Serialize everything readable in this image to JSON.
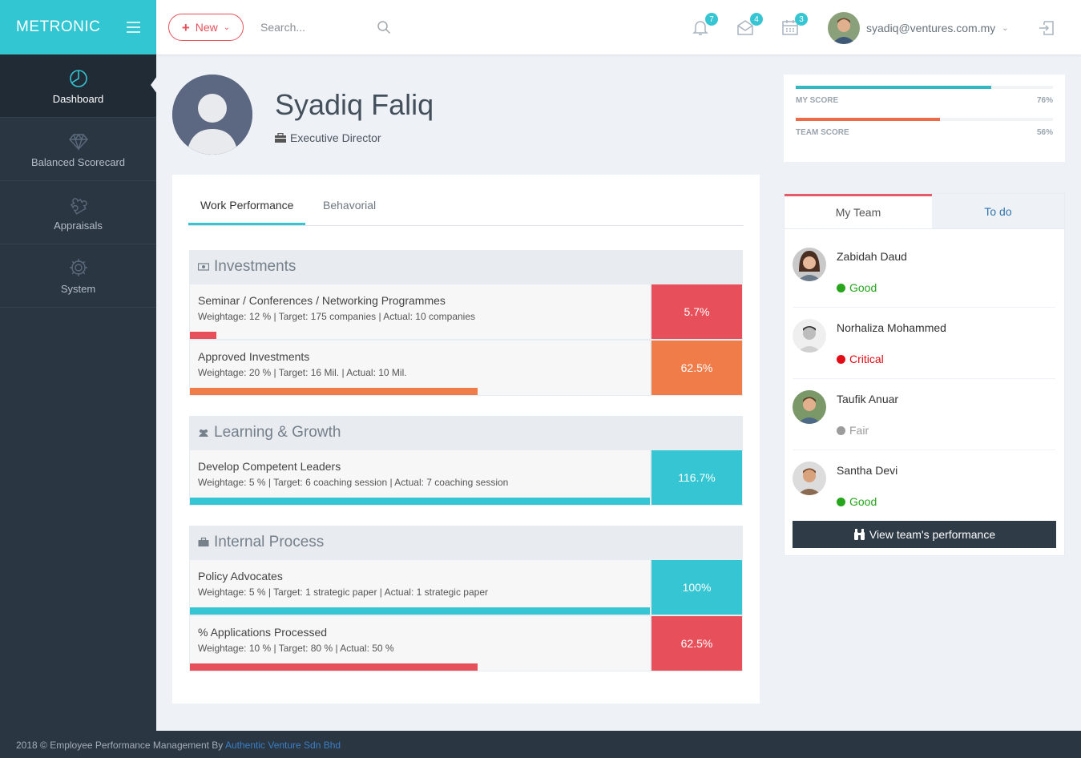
{
  "brand": "METRONIC",
  "nav": [
    {
      "label": "Dashboard",
      "icon": "pie-chart-icon"
    },
    {
      "label": "Balanced Scorecard",
      "icon": "diamond-icon"
    },
    {
      "label": "Appraisals",
      "icon": "puzzle-icon"
    },
    {
      "label": "System",
      "icon": "gear-icon"
    }
  ],
  "topbar": {
    "new_label": "New",
    "search_placeholder": "Search...",
    "notifications_count": "7",
    "inbox_count": "4",
    "calendar_count": "3",
    "user_email": "syadiq@ventures.com.my"
  },
  "profile": {
    "name": "Syadiq Faliq",
    "role": "Executive Director"
  },
  "tabs": {
    "work": "Work Performance",
    "behavioral": "Behavorial"
  },
  "categories": [
    {
      "title": "Investments",
      "rows": [
        {
          "title": "Seminar / Conferences / Networking Programmes",
          "sub": "Weightage: 12 % | Target: 175 companies | Actual: 10 companies",
          "score": "5.7%",
          "fraction": 0.057,
          "color": "#e7505a"
        },
        {
          "title": "Approved Investments",
          "sub": "Weightage: 20 % | Target: 16 Mil. | Actual: 10 Mil.",
          "score": "62.5%",
          "fraction": 0.625,
          "color": "#f07c4a"
        }
      ]
    },
    {
      "title": "Learning & Growth",
      "rows": [
        {
          "title": "Develop Competent Leaders",
          "sub": "Weightage: 5 % | Target: 6 coaching session | Actual: 7 coaching session",
          "score": "116.7%",
          "fraction": 1.0,
          "color": "#36c6d3"
        }
      ]
    },
    {
      "title": "Internal Process",
      "rows": [
        {
          "title": "Policy Advocates",
          "sub": "Weightage: 5 % | Target: 1 strategic paper | Actual: 1 strategic paper",
          "score": "100%",
          "fraction": 1.0,
          "color": "#36c6d3"
        },
        {
          "title": "% Applications Processed",
          "sub": "Weightage: 10 % | Target: 80 % | Actual: 50 %",
          "score": "62.5%",
          "fraction": 0.625,
          "color": "#e7505a"
        }
      ]
    }
  ],
  "scores": {
    "my": {
      "label": "MY SCORE",
      "value": "76%",
      "fraction": 0.76,
      "color": "#32b8c3"
    },
    "team": {
      "label": "TEAM SCORE",
      "value": "56%",
      "fraction": 0.56,
      "color": "#ed6b47"
    }
  },
  "team_tabs": {
    "my_team": "My Team",
    "todo": "To do"
  },
  "members": [
    {
      "name": "Zabidah Daud",
      "status": "Good",
      "status_color": "#26a51d",
      "avatar": "female"
    },
    {
      "name": "Norhaliza Mohammed",
      "status": "Critical",
      "status_color": "#e10c15",
      "avatar": "male-bw"
    },
    {
      "name": "Taufik Anuar",
      "status": "Fair",
      "status_color": "#9b9b9b",
      "avatar": "male"
    },
    {
      "name": "Santha Devi",
      "status": "Good",
      "status_color": "#26a51d",
      "avatar": "male2"
    }
  ],
  "view_team_label": "View team's performance",
  "footer": {
    "text": "2018 © Employee Performance Management By ",
    "link": "Authentic Venture Sdn Bhd"
  }
}
